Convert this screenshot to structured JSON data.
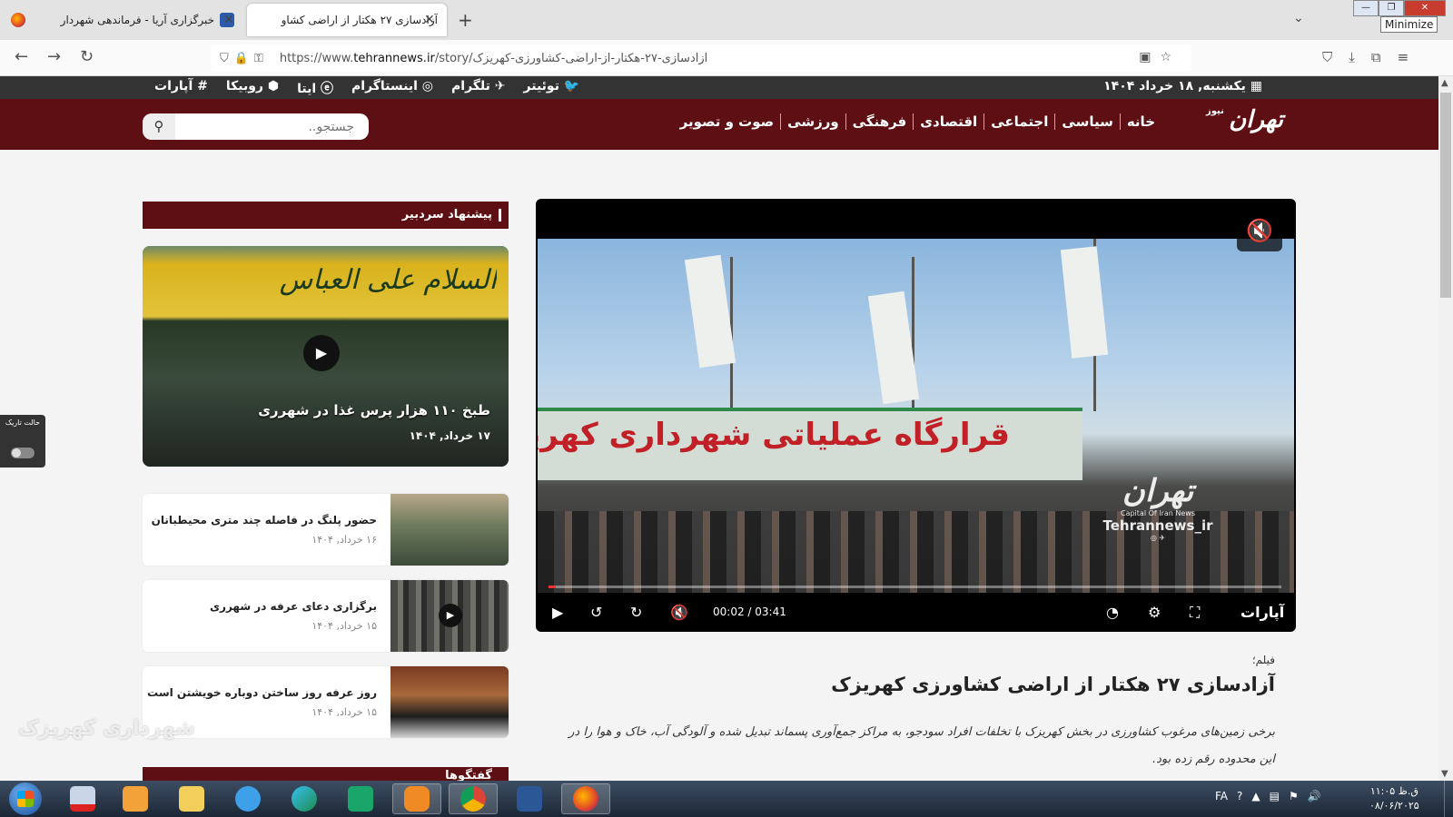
{
  "browser": {
    "tabs": [
      {
        "title": "خبرگزاری آریا - فرماندهی شهردار",
        "active": false
      },
      {
        "title": "آزادسازی ۲۷ هکتار از اراضی کشاو",
        "active": true
      }
    ],
    "new_tab_label": "+",
    "url_scheme": "https://www.",
    "url_host": "tehrannews.ir",
    "url_path": "/story/آزادسازی-۲۷-هکتار-از-اراضی-کشاورزی-کهریزک",
    "window_tooltip": "Minimize",
    "nav": {
      "back": "←",
      "forward": "→",
      "reload": "↻"
    }
  },
  "site": {
    "date": "یکشنبه, ۱۸ خرداد ۱۴۰۴",
    "social": [
      "توئیتر",
      "تلگرام",
      "اینستاگرام",
      "ایتا",
      "روبیکا",
      "آپارات"
    ],
    "logo_text": "تهران",
    "logo_sub": "نیوز",
    "menu": [
      "خانه",
      "سیاسی",
      "اجتماعی",
      "اقتصادی",
      "فرهنگی",
      "ورزشی",
      "صوت و تصویر"
    ],
    "search_placeholder": "جستجو..",
    "accent_color": "#5e0f13"
  },
  "player": {
    "banner_text": "قرارگاه عملیاتی شهرداری کهریزک",
    "watermark_logo": "تهران",
    "watermark_sub": "Capital Of Iran News",
    "watermark_handle": "Tehrannews_ir",
    "current_time": "00:02",
    "duration": "03:41",
    "time_display": "00:02 / 03:41",
    "progress": 0.01,
    "brand": "آپارات",
    "muted": true
  },
  "article": {
    "kicker": "فیلم؛",
    "headline": "آزادسازی ۲۷ هکتار از اراضی کشاورزی کهریزک",
    "lead": "برخی زمین‌های مرغوب کشاورزی در بخش کهریزک با تخلفات افراد سودجو، به مراکز جمع‌آوری پسماند تبدیل شده و آلودگی آب، خاک و هوا را در این محدوده رقم زده بود."
  },
  "sidebar": {
    "heading": "پیشنهاد سردبیر",
    "heading2": "گفتگوها",
    "featured": {
      "calligraphy": "السلام علی العباس",
      "title": "طبخ ۱۱۰ هزار پرس غذا در شهرری",
      "date": "۱۷ خرداد, ۱۴۰۴"
    },
    "items": [
      {
        "title": "حضور پلنگ در فاصله چند متری محیطبانان",
        "date": "۱۶ خرداد, ۱۴۰۴"
      },
      {
        "title": "برگزاری دعای عرفه در شهرری",
        "date": "۱۵ خرداد, ۱۴۰۴"
      },
      {
        "title": "روز عرفه روز ساختن دوباره خویشتن است",
        "date": "۱۵ خرداد, ۱۴۰۴"
      }
    ]
  },
  "dark_mode": {
    "label": "حالت تاریک",
    "enabled": false
  },
  "side_watermark": "شهرداری کهریزک",
  "taskbar": {
    "apps": [
      "pdf-reader",
      "media-player",
      "file-explorer",
      "internet-explorer",
      "edge",
      "kaspersky",
      "eitaa",
      "chrome",
      "word",
      "firefox"
    ],
    "lang": "FA",
    "time": "ق.ظ ۱۱:۰۵",
    "date": "۰۸/۰۶/۲۰۲۵"
  }
}
